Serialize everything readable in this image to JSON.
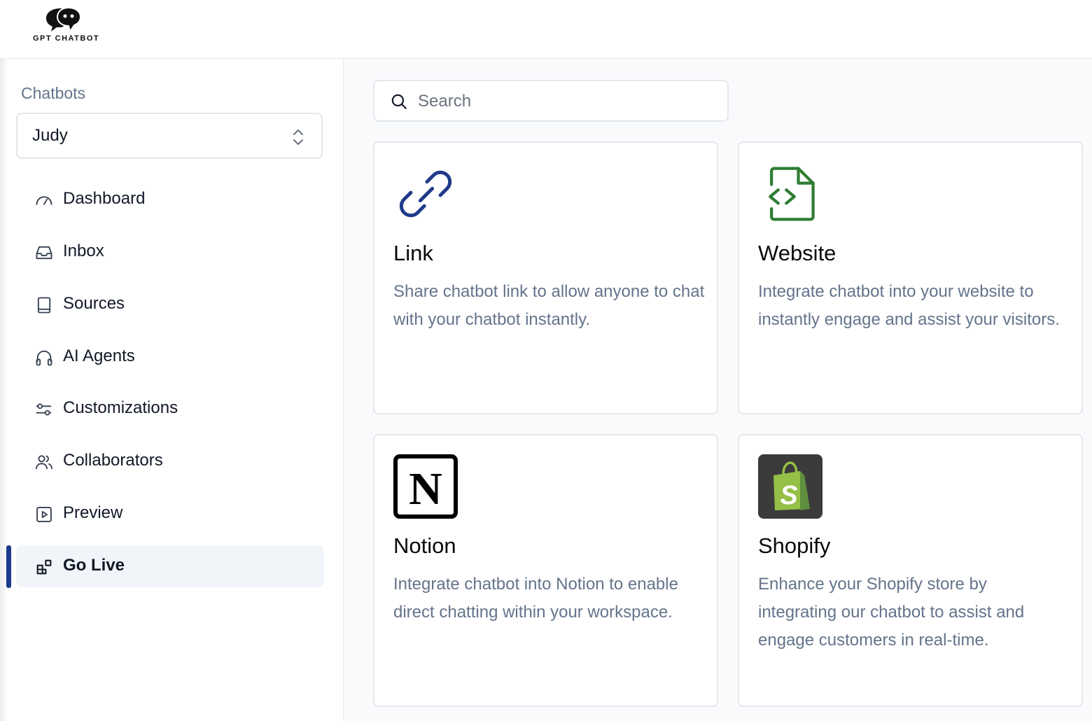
{
  "brand": {
    "name": "GPT CHATBOT"
  },
  "sidebar": {
    "heading": "Chatbots",
    "selected_chatbot": "Judy",
    "items": [
      {
        "label": "Dashboard",
        "icon": "gauge-icon"
      },
      {
        "label": "Inbox",
        "icon": "inbox-icon"
      },
      {
        "label": "Sources",
        "icon": "book-icon"
      },
      {
        "label": "AI Agents",
        "icon": "headphones-icon"
      },
      {
        "label": "Customizations",
        "icon": "sliders-icon"
      },
      {
        "label": "Collaborators",
        "icon": "users-icon"
      },
      {
        "label": "Preview",
        "icon": "play-square-icon"
      },
      {
        "label": "Go Live",
        "icon": "blocks-icon",
        "active": true
      }
    ]
  },
  "search": {
    "placeholder": "Search",
    "value": ""
  },
  "cards": [
    {
      "title": "Link",
      "description": "Share chatbot link to allow anyone to chat with your chatbot instantly.",
      "icon": "link-icon",
      "color": "#1e3a8a"
    },
    {
      "title": "Website",
      "description": "Integrate chatbot into your website to instantly engage and assist your visitors.",
      "icon": "file-code-icon",
      "color": "#2e7d32"
    },
    {
      "title": "Notion",
      "description": "Integrate chatbot into Notion to enable direct chatting within your workspace.",
      "icon": "notion-logo-icon",
      "color": "#000000"
    },
    {
      "title": "Shopify",
      "description": "Enhance your Shopify store by integrating our chatbot to assist and engage customers in real-time.",
      "icon": "shopify-logo-icon",
      "color": "#95bf47"
    }
  ],
  "colors": {
    "accent": "#1e3a8a",
    "muted_text": "#64748b",
    "border": "#e5e7eb",
    "main_bg": "#f8fafc"
  }
}
